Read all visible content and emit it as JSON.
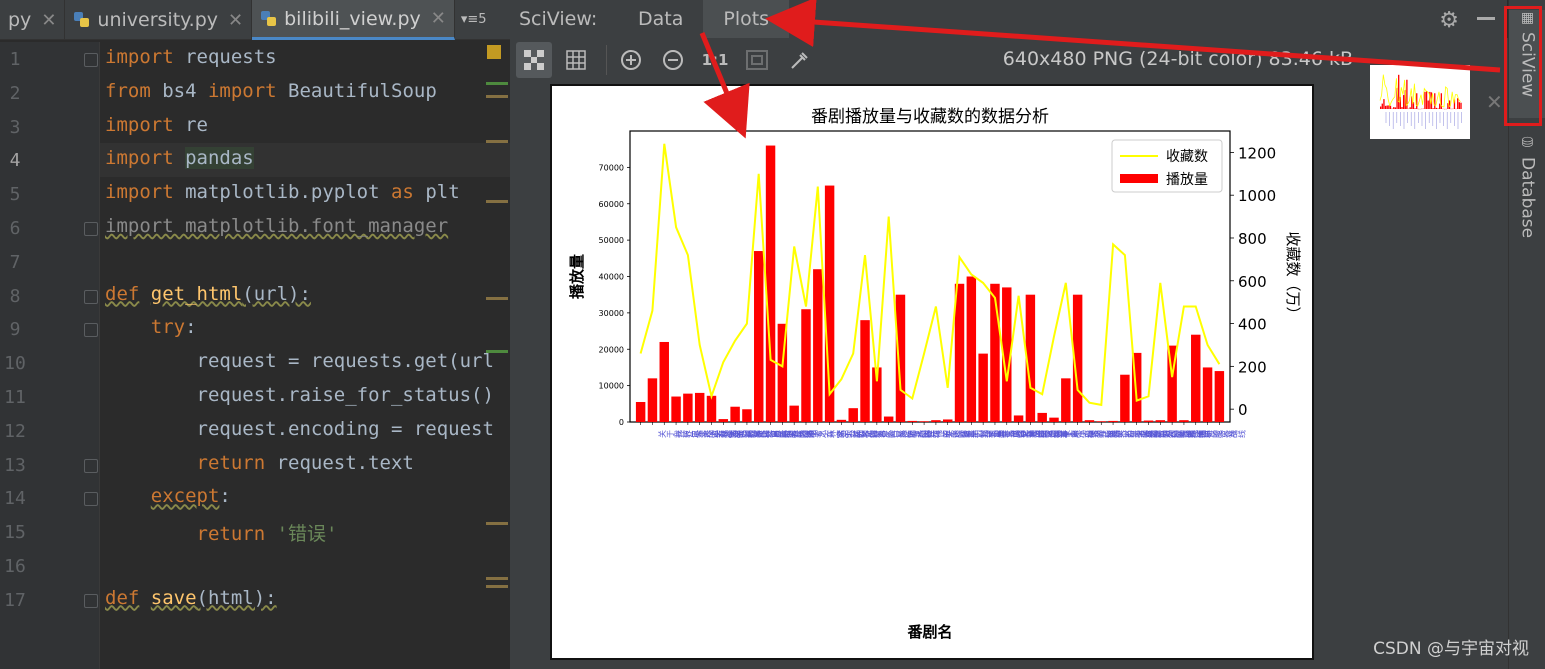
{
  "editor": {
    "tabs": [
      {
        "label": "py",
        "closable": true,
        "active": false
      },
      {
        "label": "university.py",
        "closable": true,
        "active": false
      },
      {
        "label": "bilibili_view.py",
        "closable": true,
        "active": true
      }
    ],
    "tab_overflow": "▾≡5",
    "lines": [
      {
        "n": "1",
        "html": "<span class='kw'>import</span> requests"
      },
      {
        "n": "2",
        "html": "<span class='kw'>from</span> bs4 <span class='kw'>import</span> BeautifulSoup"
      },
      {
        "n": "3",
        "html": "<span class='kw'>import</span> re"
      },
      {
        "n": "4",
        "html": "<span class='kw'>import</span> <span class='hl'>pandas</span>"
      },
      {
        "n": "5",
        "html": "<span class='kw'>import</span> matplotlib.pyplot <span class='kw'>as</span> plt"
      },
      {
        "n": "6",
        "html": "<span class='gray ul'>import matplotlib.font_manager</span>"
      },
      {
        "n": "7",
        "html": ""
      },
      {
        "n": "8",
        "html": "<span class='kw ul'>def</span> <span class='fn ul'>get_html</span><span class='ul'>(url):</span>"
      },
      {
        "n": "9",
        "html": "    <span class='kw'>try</span>:"
      },
      {
        "n": "10",
        "html": "        request = requests.get(url"
      },
      {
        "n": "11",
        "html": "        request.raise_for_status()"
      },
      {
        "n": "12",
        "html": "        request.encoding = request"
      },
      {
        "n": "13",
        "html": "        <span class='kw'>return</span> request.text"
      },
      {
        "n": "14",
        "html": "    <span class='kw ul'>except</span>:"
      },
      {
        "n": "15",
        "html": "        <span class='kw'>return</span> <span class='st'>'错误'</span>"
      },
      {
        "n": "16",
        "html": ""
      },
      {
        "n": "17",
        "html": "<span class='kw ul'>def</span> <span class='fn ul'>save</span><span class='ul'>(html):</span>"
      }
    ]
  },
  "sciview": {
    "title": "SciView:",
    "tabs": [
      "Data",
      "Plots"
    ],
    "active_tab": "Plots",
    "image_info": "640x480 PNG (24-bit color) 83.46 kB"
  },
  "sidebar": {
    "items": [
      "SciView",
      "Database"
    ]
  },
  "watermark": "CSDN @与宇宙对视",
  "chart_data": {
    "type": "bar",
    "title": "番剧播放量与收藏数的数据分析",
    "xlabel": "番剧名",
    "ylabel": "播放量",
    "y2label": "收藏数（万）",
    "ylim": [
      0,
      80000
    ],
    "y2lim": [
      -60,
      1300
    ],
    "yticks": [
      0,
      10000,
      20000,
      30000,
      40000,
      50000,
      60000,
      70000
    ],
    "y2ticks": [
      0,
      200,
      400,
      600,
      800,
      1000,
      1200
    ],
    "legend": [
      "收藏数",
      "播放量"
    ],
    "legend_position": "top-right",
    "bar_color": "#ff0000",
    "line_color": "#ffff00",
    "bar_values": [
      5500,
      12000,
      22000,
      7000,
      7800,
      8000,
      7200,
      800,
      4200,
      3500,
      47000,
      76000,
      27000,
      4500,
      31000,
      42000,
      65000,
      600,
      3800,
      28000,
      15000,
      1500,
      35000,
      300,
      200,
      500,
      700,
      38000,
      40000,
      18800,
      38000,
      37000,
      1800,
      35000,
      2500,
      1200,
      12000,
      35000,
      500,
      200,
      300,
      13000,
      19000,
      400,
      500,
      21000,
      500,
      24000,
      15000,
      14000
    ],
    "line_values": [
      260,
      460,
      1240,
      850,
      720,
      300,
      60,
      220,
      320,
      400,
      1100,
      230,
      200,
      760,
      480,
      1040,
      70,
      140,
      260,
      720,
      130,
      900,
      90,
      50,
      260,
      480,
      100,
      710,
      630,
      590,
      520,
      130,
      530,
      100,
      70,
      340,
      590,
      90,
      30,
      20,
      770,
      720,
      40,
      60,
      590,
      150,
      480,
      480,
      300,
      210
    ],
    "category_label_rows": [
      "关于我转生变成史莱姆这档事",
      "世界尽头的圣骑士",
      "鬼灭之刃 无限列车篇",
      "小林家的龙女仆 第二季",
      "JOJO的奇妙冒险 石之海",
      "我被逐出勇者队伍",
      "世界最强暗杀者",
      "宿命回响",
      "进化之实 踏上胜利的人生",
      "小林家的龙女仆",
      "JOJO的奇妙冒险 黄金之风",
      "创之月",
      "紫罗兰永恒花园",
      "白沙的水族馆",
      "平稳世代的韦驮天们",
      "异世界迷宫黑心企业",
      "无职转生 到了异世界就拿出真本事",
      "关于我转生变成史莱姆这档事 第二季",
      "OVERLORD Ⅲ",
      "赛马娘 第二季",
      "OVERLORD Ⅱ",
      "迷宫饭",
      "辉夜大小姐想让我告白 第三季",
      "魔法使的新娘",
      "青春猪头少年不会梦到兔女郎学姐",
      "鬼灭之刃 游郭篇",
      "为美好的世界献上祝福",
      "命运-冠位指定 绝对魔兽战线",
      "刀剑神域",
      "齐木楠雄的灾难"
    ]
  }
}
